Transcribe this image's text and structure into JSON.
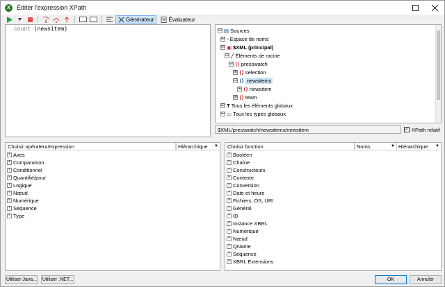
{
  "window": {
    "title": "Éditer l'expression XPath",
    "app_icon": "X"
  },
  "toolbar": {
    "generator_label": "Générateur",
    "evaluator_label": "Évaluateur"
  },
  "editor": {
    "keyword": "count",
    "argument": " (newsitem)"
  },
  "tree": {
    "rows": [
      {
        "label": "Sources",
        "expander": "⊟"
      },
      {
        "label": "Espace de noms",
        "expander": "⊞"
      },
      {
        "label": "$XML (principal)",
        "expander": "⊟"
      },
      {
        "label": "Éléments de racine",
        "expander": "⊟"
      },
      {
        "label": "presswatch",
        "expander": "⊟"
      },
      {
        "label": "selection",
        "expander": "⊞"
      },
      {
        "label": "newsitems",
        "expander": "⊟"
      },
      {
        "label": "newsitem",
        "expander": "⊞"
      },
      {
        "label": "team",
        "expander": "⊞"
      },
      {
        "label": "Tous les éléments globaux",
        "expander": "⊞"
      },
      {
        "label": "Tous les types globaux",
        "expander": "⊞"
      }
    ],
    "path": "$XML/presswatch/newsitems/newsitem",
    "xpath_relative_label": "XPath relatif",
    "xpath_relative_checked": "✓"
  },
  "operators": {
    "header": "Choisir opérateur/expression",
    "view": "Hiérarchique",
    "items": [
      "Axes",
      "Comparaison",
      "Conditionnel",
      "Quantifié/pour",
      "Logique",
      "Nœud",
      "Numérique",
      "Séquence",
      "Type"
    ]
  },
  "functions": {
    "header": "Choisir fonction",
    "names_view": "Noms",
    "view": "Hiérarchique",
    "items": [
      "Booléen",
      "Chaîne",
      "Constructeurs",
      "Contexte",
      "Conversion",
      "Date et heure",
      "Fichiers, OS, URI",
      "Général",
      "ID",
      "Instance XBRL",
      "Numérique",
      "Nœud",
      "QName",
      "Séquence",
      "XBRL Extensions"
    ]
  },
  "footer": {
    "java_label": "Utiliser Java...",
    "net_label": "Utiliser .NET...",
    "ok_label": "OK",
    "cancel_label": "Annuler"
  },
  "colors": {
    "selection": "#cce4f7",
    "accent": "#0078d7",
    "element_icon": "#c02020"
  }
}
